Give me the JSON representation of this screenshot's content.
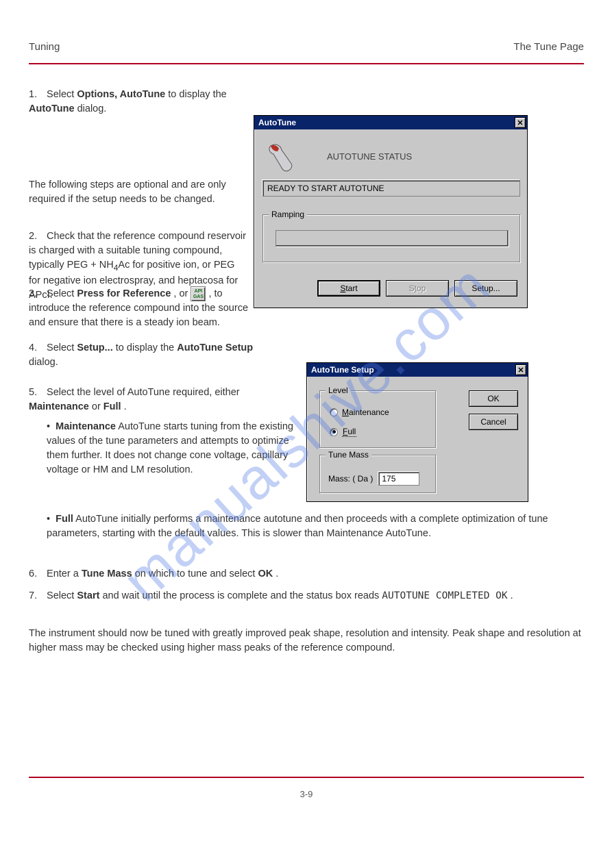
{
  "page": {
    "header_left": "Tuning",
    "header_right": "The Tune Page",
    "page_number": "3-9",
    "watermark": "manualshive.com"
  },
  "step1": {
    "num": "1.",
    "text_a": "Select ",
    "menu": "Options, AutoTune",
    "text_b": " to display the ",
    "dlg_name": "AutoTune",
    "text_c": " dialog."
  },
  "autotune_dialog": {
    "title": "AutoTune",
    "heading": "AUTOTUNE STATUS",
    "status": "READY TO START AUTOTUNE",
    "ramping_legend": "Ramping",
    "ramping_value": "",
    "start": "Start",
    "stop": "Stop",
    "setup": "Setup..."
  },
  "step2_lead": "The following steps are optional and are only required if the setup needs to be changed.",
  "step2": {
    "num": "2.",
    "text_a": "Check that the reference compound reservoir is charged with a suitable tuning compound, typically PEG + NH",
    "sub": "4",
    "text_b": "Ac for positive ion, or PEG for negative ion electrospray, and heptacosa for APcI."
  },
  "step3": {
    "num": "3.",
    "text_a": "Select ",
    "btn": "Press for Reference",
    "text_b": ", or ",
    "text_c": ", to introduce the reference compound into the source and ensure that there is a steady ion beam."
  },
  "step4": {
    "num": "4.",
    "text_a": "Select ",
    "btn": "Setup...",
    "text_b": " to display the ",
    "dlg_name": "AutoTune Setup",
    "text_c": " dialog."
  },
  "setup_dialog": {
    "title": "AutoTune Setup",
    "level_legend": "Level",
    "maintenance_label": "Maintenance",
    "full_label": "Full",
    "full_checked": true,
    "tune_legend": "Tune Mass",
    "mass_label": "Mass: ( Da )",
    "mass_value": "175",
    "ok": "OK",
    "cancel": "Cancel"
  },
  "step5": {
    "num": "5.",
    "text_a": "Select the level of AutoTune required, either ",
    "opt1": "Maintenance",
    "mid": " or ",
    "opt2": "Full",
    "tail": "."
  },
  "bullets": {
    "b1a": "Maintenance",
    "b1b": " AutoTune starts tuning from the existing values of the tune parameters and attempts to optimize them further. It does not change cone voltage, capillary voltage or HM and LM resolution.",
    "b2a": "Full",
    "b2b": " AutoTune initially performs a maintenance autotune and then proceeds with a complete optimization of tune parameters, starting with the default values. This is slower than Maintenance AutoTune."
  },
  "step6": {
    "num": "6.",
    "text_a": "Enter a ",
    "opt": "Tune Mass",
    "text_b": " on which to tune and select ",
    "btn": "OK",
    "text_c": "."
  },
  "step7": {
    "num": "7.",
    "text_a": "Select ",
    "btn": "Start",
    "text_b": " and wait until the process is complete and the status box reads ",
    "status": "AUTOTUNE COMPLETED OK",
    "tail": "."
  },
  "final": "The instrument should now be tuned with greatly improved peak shape, resolution and intensity. Peak shape and resolution at higher mass may be checked using higher mass peaks of the reference compound."
}
